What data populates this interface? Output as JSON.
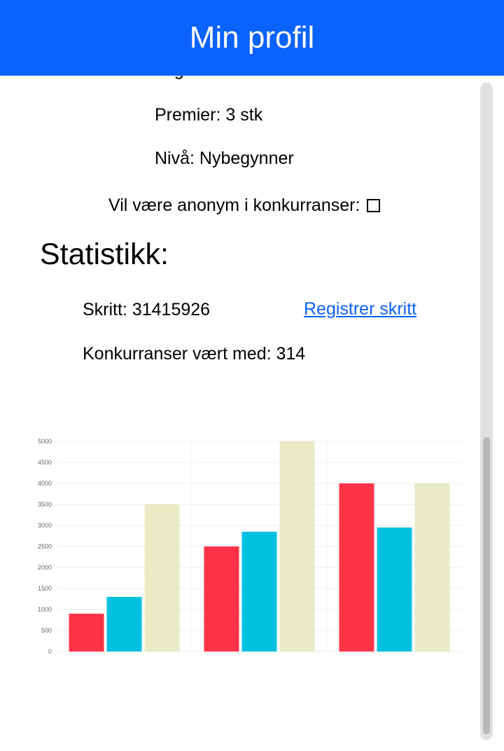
{
  "header": {
    "title": "Min profil"
  },
  "profile": {
    "lag": "Lag: Sverre & venner",
    "premier": "Premier: 3 stk",
    "niva": "Nivå: Nybegynner",
    "anonymous_label": "Vil være anonym i konkurranser:",
    "anonymous_checked": false
  },
  "stats": {
    "title": "Statistikk:",
    "steps": "Skritt: 31415926",
    "register_link": "Registrer skritt",
    "competitions": "Konkurranser vært med: 314"
  },
  "chart_data": {
    "type": "bar",
    "categories": [
      "",
      "",
      ""
    ],
    "series": [
      {
        "values": [
          900,
          2500,
          4000
        ],
        "color": "#ff3347"
      },
      {
        "values": [
          1300,
          2850,
          2950
        ],
        "color": "#00c0e0"
      },
      {
        "values": [
          3500,
          5000,
          4000
        ],
        "color": "#e8ebc4"
      }
    ],
    "ylim": [
      0,
      5000
    ],
    "yticks": [
      0,
      500,
      1000,
      1500,
      2000,
      2500,
      3000,
      3500,
      4000,
      4500,
      5000
    ],
    "grid": true,
    "legend": "none"
  }
}
